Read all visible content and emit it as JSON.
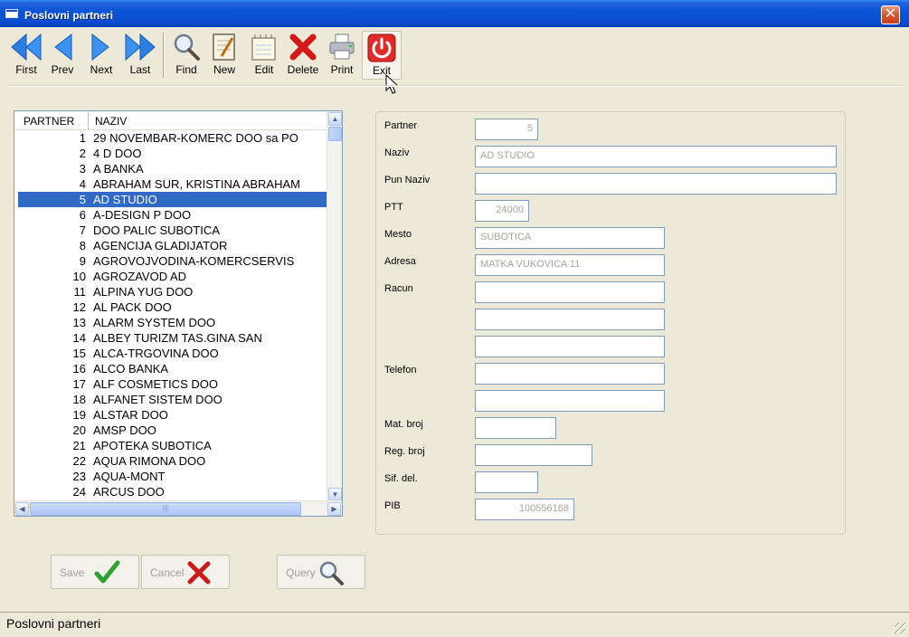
{
  "window": {
    "title": "Poslovni partneri",
    "close_symbol": "✕"
  },
  "toolbar": {
    "first": "First",
    "prev": "Prev",
    "next": "Next",
    "last": "Last",
    "find": "Find",
    "new": "New",
    "edit": "Edit",
    "delete": "Delete",
    "print": "Print",
    "exit": "Exit"
  },
  "list": {
    "columns": {
      "partner": "PARTNER",
      "naziv": "NAZIV"
    },
    "selected_index": 4,
    "rows": [
      {
        "num": "1",
        "name": "29 NOVEMBAR-KOMERC DOO sa PO"
      },
      {
        "num": "2",
        "name": "4 D DOO"
      },
      {
        "num": "3",
        "name": "A BANKA"
      },
      {
        "num": "4",
        "name": "ABRAHAM SUR, KRISTINA ABRAHAM"
      },
      {
        "num": "5",
        "name": "AD STUDIO"
      },
      {
        "num": "6",
        "name": "A-DESIGN P DOO"
      },
      {
        "num": "7",
        "name": "DOO PALIC SUBOTICA"
      },
      {
        "num": "8",
        "name": "AGENCIJA GLADIJATOR"
      },
      {
        "num": "9",
        "name": "AGROVOJVODINA-KOMERCSERVIS"
      },
      {
        "num": "10",
        "name": "AGROZAVOD AD"
      },
      {
        "num": "11",
        "name": "ALPINA YUG DOO"
      },
      {
        "num": "12",
        "name": "AL PACK DOO"
      },
      {
        "num": "13",
        "name": "ALARM SYSTEM DOO"
      },
      {
        "num": "14",
        "name": "ALBEY TURIZM TAS.GINA SAN"
      },
      {
        "num": "15",
        "name": "ALCA-TRGOVINA DOO"
      },
      {
        "num": "16",
        "name": "ALCO BANKA"
      },
      {
        "num": "17",
        "name": "ALF COSMETICS DOO"
      },
      {
        "num": "18",
        "name": "ALFANET SISTEM DOO"
      },
      {
        "num": "19",
        "name": "ALSTAR DOO"
      },
      {
        "num": "20",
        "name": "AMSP DOO"
      },
      {
        "num": "21",
        "name": "APOTEKA SUBOTICA"
      },
      {
        "num": "22",
        "name": "AQUA RIMONA DOO"
      },
      {
        "num": "23",
        "name": "AQUA-MONT"
      },
      {
        "num": "24",
        "name": "ARCUS DOO"
      }
    ]
  },
  "form": {
    "labels": {
      "partner": "Partner",
      "naziv": "Naziv",
      "pun_naziv": "Pun Naziv",
      "ptt": "PTT",
      "mesto": "Mesto",
      "adresa": "Adresa",
      "racun": "Racun",
      "telefon": "Telefon",
      "mat_broj": "Mat. broj",
      "reg_broj": "Reg. broj",
      "sif_del": "Sif. del.",
      "pib": "PIB"
    },
    "values": {
      "partner": "5",
      "naziv": "AD STUDIO",
      "pun_naziv": "",
      "ptt": "24000",
      "mesto": "SUBOTICA",
      "adresa": "MATKA VUKOVICA 11",
      "racun1": "",
      "racun2": "",
      "racun3": "",
      "telefon1": "",
      "telefon2": "",
      "mat_broj": "",
      "reg_broj": "",
      "sif_del": "",
      "pib": "100556168"
    }
  },
  "actions": {
    "save": "Save",
    "cancel": "Cancel",
    "query": "Query"
  },
  "status": {
    "text": "Poslovni partneri"
  },
  "colors": {
    "titlebar": "#0a53d7",
    "selection": "#316ac5",
    "window_bg": "#ece9d8"
  }
}
